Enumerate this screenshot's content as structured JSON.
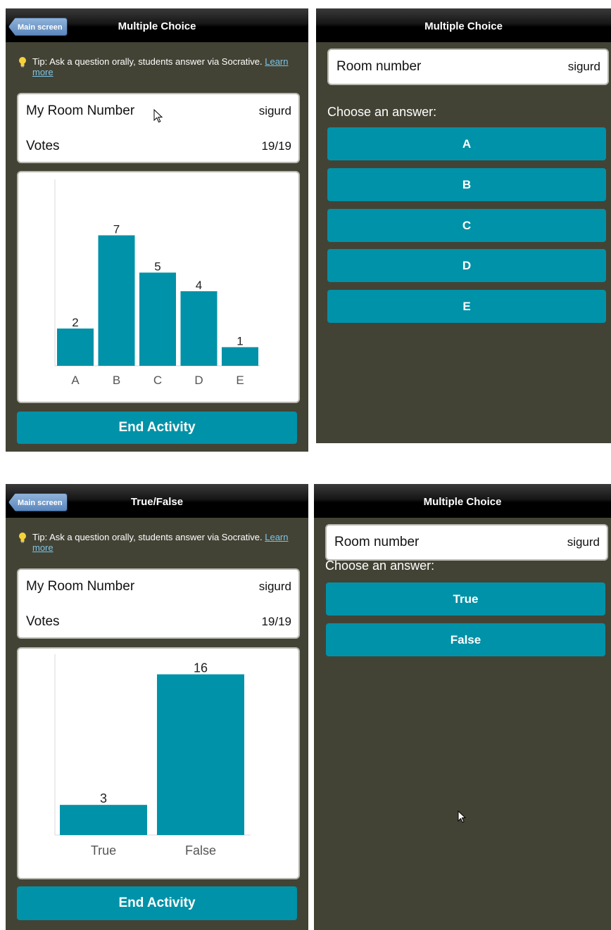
{
  "screens": {
    "teacher_mc": {
      "back_label": "Main screen",
      "title": "Multiple Choice",
      "tip_text": "Tip: Ask a question orally, students answer via Socrative.",
      "tip_link": "Learn more",
      "room_label": "My Room Number",
      "room_value": "sigurd",
      "votes_label": "Votes",
      "votes_value": "19/19",
      "end_label": "End Activity"
    },
    "student_mc": {
      "title": "Multiple Choice",
      "room_label": "Room number",
      "room_value": "sigurd",
      "choose_label": "Choose an answer:",
      "answers": [
        "A",
        "B",
        "C",
        "D",
        "E"
      ]
    },
    "teacher_tf": {
      "back_label": "Main screen",
      "title": "True/False",
      "tip_text": "Tip: Ask a question orally, students answer via Socrative.",
      "tip_link": "Learn more",
      "room_label": "My Room Number",
      "room_value": "sigurd",
      "votes_label": "Votes",
      "votes_value": "19/19",
      "end_label": "End Activity"
    },
    "student_tf": {
      "title": "Multiple Choice",
      "room_label": "Room number",
      "room_value": "sigurd",
      "choose_label": "Choose an answer:",
      "answers": [
        "True",
        "False"
      ]
    }
  },
  "colors": {
    "accent": "#0092a8",
    "background": "#434335",
    "link": "#7cc4e6"
  },
  "chart_data": [
    {
      "type": "bar",
      "categories": [
        "A",
        "B",
        "C",
        "D",
        "E"
      ],
      "values": [
        2,
        7,
        5,
        4,
        1
      ],
      "title": "",
      "xlabel": "",
      "ylabel": "",
      "ylim": [
        0,
        10
      ],
      "grid": false
    },
    {
      "type": "bar",
      "categories": [
        "True",
        "False"
      ],
      "values": [
        3,
        16
      ],
      "title": "",
      "xlabel": "",
      "ylabel": "",
      "ylim": [
        0,
        18
      ],
      "grid": false
    }
  ]
}
